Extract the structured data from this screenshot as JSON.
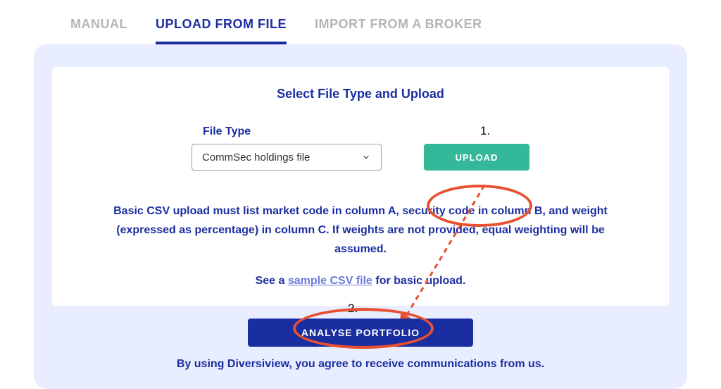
{
  "tabs": {
    "manual": "MANUAL",
    "upload": "UPLOAD FROM FILE",
    "broker": "IMPORT FROM A BROKER"
  },
  "card": {
    "title": "Select File Type and Upload",
    "file_type_label": "File Type",
    "file_type_value": "CommSec holdings file",
    "upload_button": "UPLOAD",
    "instructions": "Basic CSV upload must list market code in column A, security code in column B, and weight (expressed as percentage) in column C. If weights are not provided, equal weighting will be assumed.",
    "sample_prefix": "See a ",
    "sample_link": "sample CSV file",
    "sample_suffix": " for basic upload."
  },
  "analyse_button": "ANALYSE PORTFOLIO",
  "disclaimer": "By using Diversiview, you agree to receive communications from us.",
  "annotations": {
    "step1": "1.",
    "step2": "2."
  }
}
